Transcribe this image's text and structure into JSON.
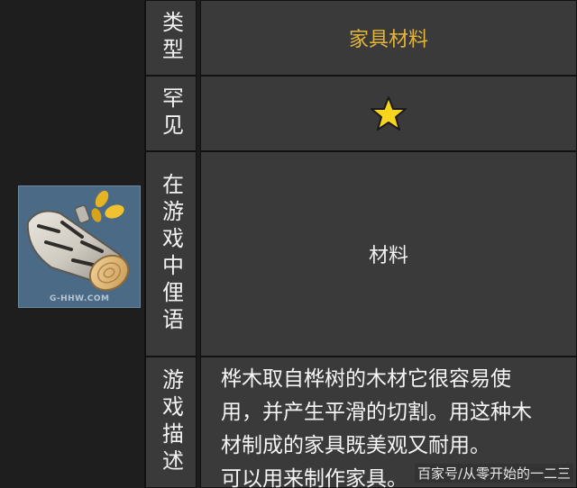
{
  "item": {
    "icon_name": "birch-wood-log-icon",
    "watermark": "G-HHW.COM"
  },
  "rows": {
    "type": {
      "label": "类型",
      "value": "家具材料"
    },
    "rarity": {
      "label": "罕见",
      "stars": 1,
      "star_icon": "star-icon",
      "star_color": "#f7d51e"
    },
    "ingame_name": {
      "label": "在游戏中俚语",
      "value": "材料"
    },
    "description": {
      "label": "游戏描述",
      "lines": [
        "桦木取自桦树的木材它很容易使",
        "用，并产生平滑的切割。用这种木",
        "材制成的家具既美观又耐用。",
        "可以用来制作家具。"
      ]
    }
  },
  "source_tag": "百家号/从零开始的一二三",
  "colors": {
    "background": "#1c1c1c",
    "cell": "#3a3a3a",
    "accent_gold": "#e3b53a",
    "icon_bg": "#4b6a86"
  }
}
